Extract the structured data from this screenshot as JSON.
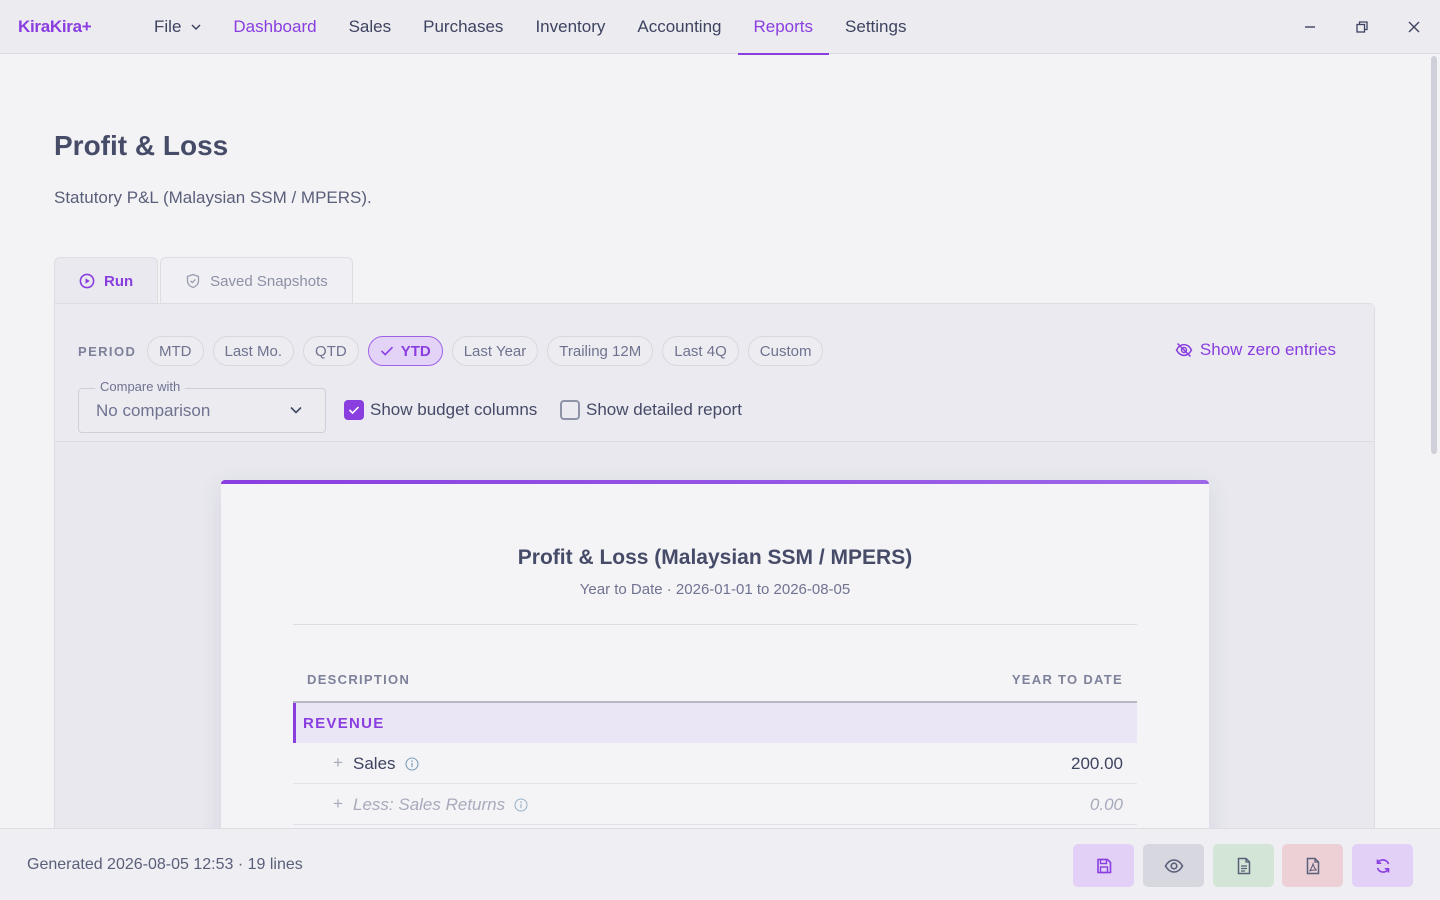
{
  "app": {
    "name": "KiraKira+"
  },
  "nav": {
    "file": "File",
    "items": [
      "Dashboard",
      "Sales",
      "Purchases",
      "Inventory",
      "Accounting",
      "Reports",
      "Settings"
    ],
    "active": "Reports"
  },
  "page": {
    "title": "Profit & Loss",
    "subtitle": "Statutory P&L (Malaysian SSM / MPERS)."
  },
  "tabs": {
    "run": "Run",
    "snapshots": "Saved Snapshots"
  },
  "period": {
    "label": "PERIOD",
    "chips": [
      "MTD",
      "Last Mo.",
      "QTD",
      "YTD",
      "Last Year",
      "Trailing 12M",
      "Last 4Q",
      "Custom"
    ],
    "selected": "YTD"
  },
  "show_zero_label": "Show zero entries",
  "compare": {
    "label": "Compare with",
    "value": "No comparison"
  },
  "options": {
    "budget": {
      "label": "Show budget columns",
      "checked": true
    },
    "detailed": {
      "label": "Show detailed report",
      "checked": false
    }
  },
  "report": {
    "title": "Profit & Loss (Malaysian SSM / MPERS)",
    "subtitle": "Year to Date · 2026-01-01 to 2026-08-05",
    "col_description": "DESCRIPTION",
    "col_value": "YEAR TO DATE",
    "section": "REVENUE",
    "lines": [
      {
        "name": "Sales",
        "value": "200.00"
      },
      {
        "name": "Less: Sales Returns",
        "value": "0.00"
      }
    ]
  },
  "footer": {
    "generated": "Generated 2026-08-05 12:53 · 19 lines"
  },
  "colors": {
    "accent": "#8a3ee0",
    "text": "#454a66",
    "muted": "#7d8199"
  }
}
